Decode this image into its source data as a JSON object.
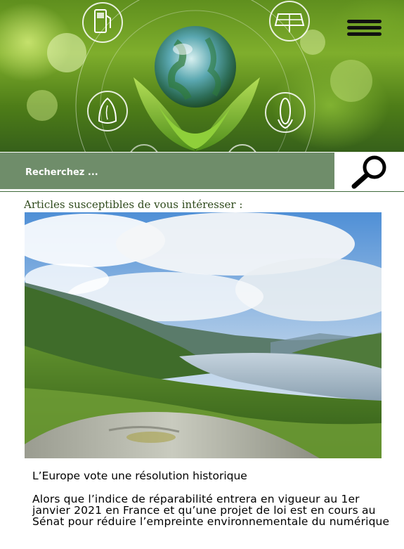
{
  "header": {
    "menu_icon": "hamburger-menu-icon",
    "hero_icons": [
      "fuel-pump-icon",
      "earth-globe-icon",
      "solar-panel-icon",
      "water-leaf-icon",
      "corn-icon"
    ]
  },
  "search": {
    "placeholder": "Recherchez ...",
    "button_icon": "search-icon"
  },
  "section": {
    "title": "Articles susceptibles de vous intéresser :"
  },
  "article": {
    "title": "L’Europe vote une résolution historique",
    "excerpt": "Alors que l’indice de réparabilité entrera en vigueur au 1er janvier 2021 en France et qu’une projet de loi est en cours au Sénat pour réduire l’empreinte environnementale du numérique"
  },
  "colors": {
    "search_bar": "#6f8d6a",
    "section_title": "#2f4a1c"
  }
}
